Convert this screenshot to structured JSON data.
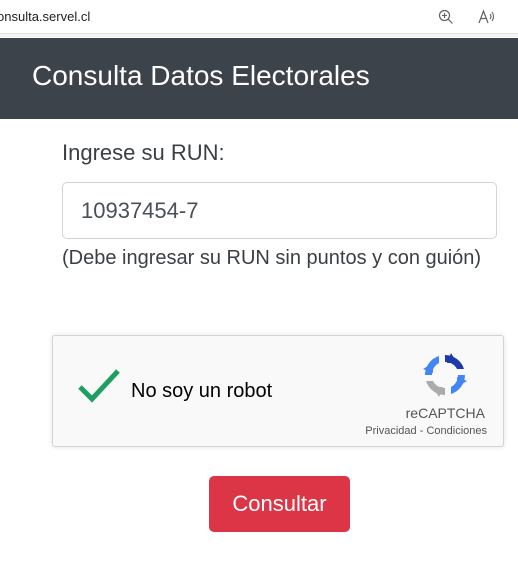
{
  "browser": {
    "url": "onsulta.servel.cl",
    "icons": [
      "zoom-icon",
      "read-aloud-icon"
    ]
  },
  "header": {
    "title": "Consulta Datos Electorales",
    "background": "#3d434a"
  },
  "form": {
    "run_label": "Ingrese su RUN:",
    "run_value": "10937454-7",
    "run_hint": "(Debe ingresar su RUN sin puntos y con guión)"
  },
  "recaptcha": {
    "label": "No soy un robot",
    "brand": "reCAPTCHA",
    "privacy": "Privacidad",
    "separator": "-",
    "terms": "Condiciones",
    "checked": true,
    "check_color": "#1e9f62"
  },
  "submit": {
    "label": "Consultar",
    "color": "#dc3545"
  }
}
